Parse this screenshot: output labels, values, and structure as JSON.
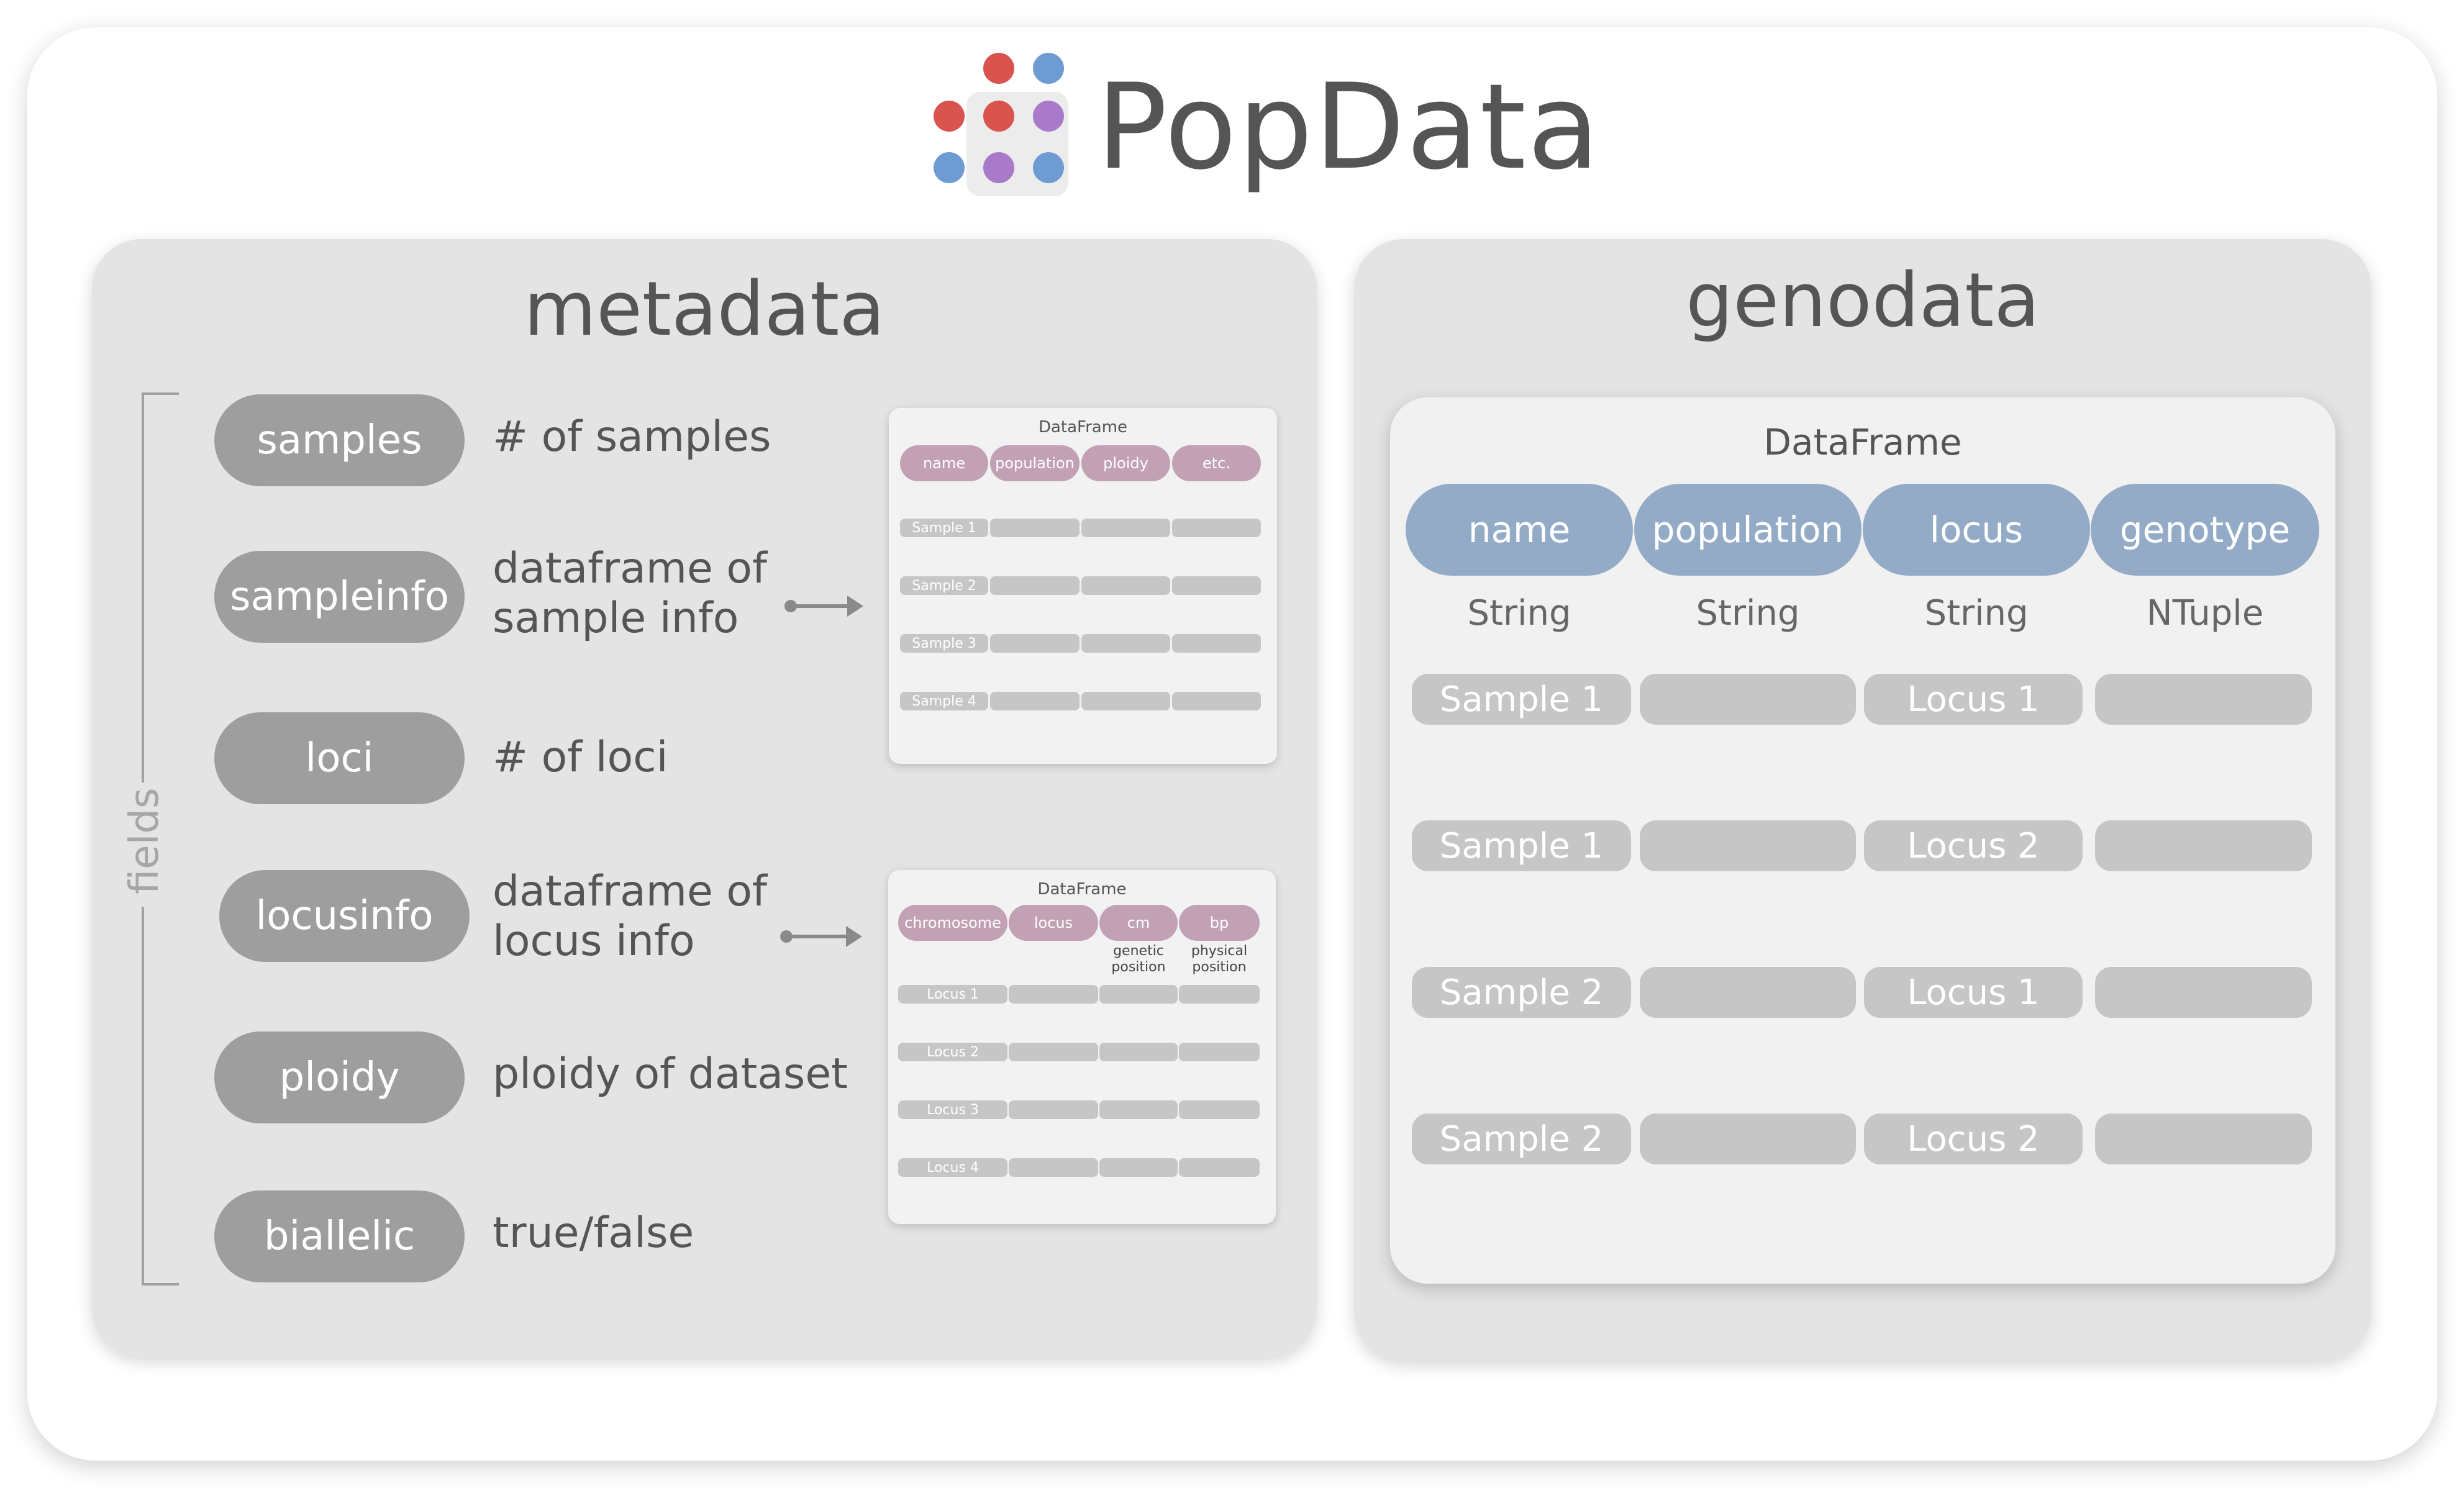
{
  "title": "PopData",
  "colors": {
    "red": "#d9534f",
    "blue": "#6f9bd3",
    "purple": "#a97ac9",
    "field_pill": "#9e9e9e",
    "meta_header": "#c2a1b5",
    "geno_header": "#93abc7",
    "cell": "#c6c6c6"
  },
  "metadata": {
    "title": "metadata",
    "fields_label": "fields",
    "fields": [
      {
        "name": "samples",
        "desc": [
          "# of samples"
        ]
      },
      {
        "name": "sampleinfo",
        "desc": [
          "dataframe of",
          "sample info"
        ]
      },
      {
        "name": "loci",
        "desc": [
          "# of loci"
        ]
      },
      {
        "name": "locusinfo",
        "desc": [
          "dataframe of",
          "locus info"
        ]
      },
      {
        "name": "ploidy",
        "desc": [
          "ploidy of dataset"
        ]
      },
      {
        "name": "biallelic",
        "desc": [
          "true/false"
        ]
      }
    ],
    "sample_df": {
      "title": "DataFrame",
      "headers": [
        "name",
        "population",
        "ploidy",
        "etc."
      ],
      "rows": [
        "Sample 1",
        "Sample 2",
        "Sample 3",
        "Sample 4"
      ]
    },
    "locus_df": {
      "title": "DataFrame",
      "headers": [
        "chromosome",
        "locus",
        "cm",
        "bp"
      ],
      "subs": [
        "",
        "",
        "genetic\nposition",
        "physical\nposition"
      ],
      "rows": [
        "Locus 1",
        "Locus 2",
        "Locus 3",
        "Locus 4"
      ]
    }
  },
  "genodata": {
    "title": "genodata",
    "df_title": "DataFrame",
    "columns": [
      {
        "name": "name",
        "type": "String"
      },
      {
        "name": "population",
        "type": "String"
      },
      {
        "name": "locus",
        "type": "String"
      },
      {
        "name": "genotype",
        "type": "NTuple"
      }
    ],
    "rows": [
      {
        "sample": "Sample 1",
        "locus": "Locus 1"
      },
      {
        "sample": "Sample 1",
        "locus": "Locus 2"
      },
      {
        "sample": "Sample 2",
        "locus": "Locus 1"
      },
      {
        "sample": "Sample 2",
        "locus": "Locus 2"
      }
    ]
  }
}
